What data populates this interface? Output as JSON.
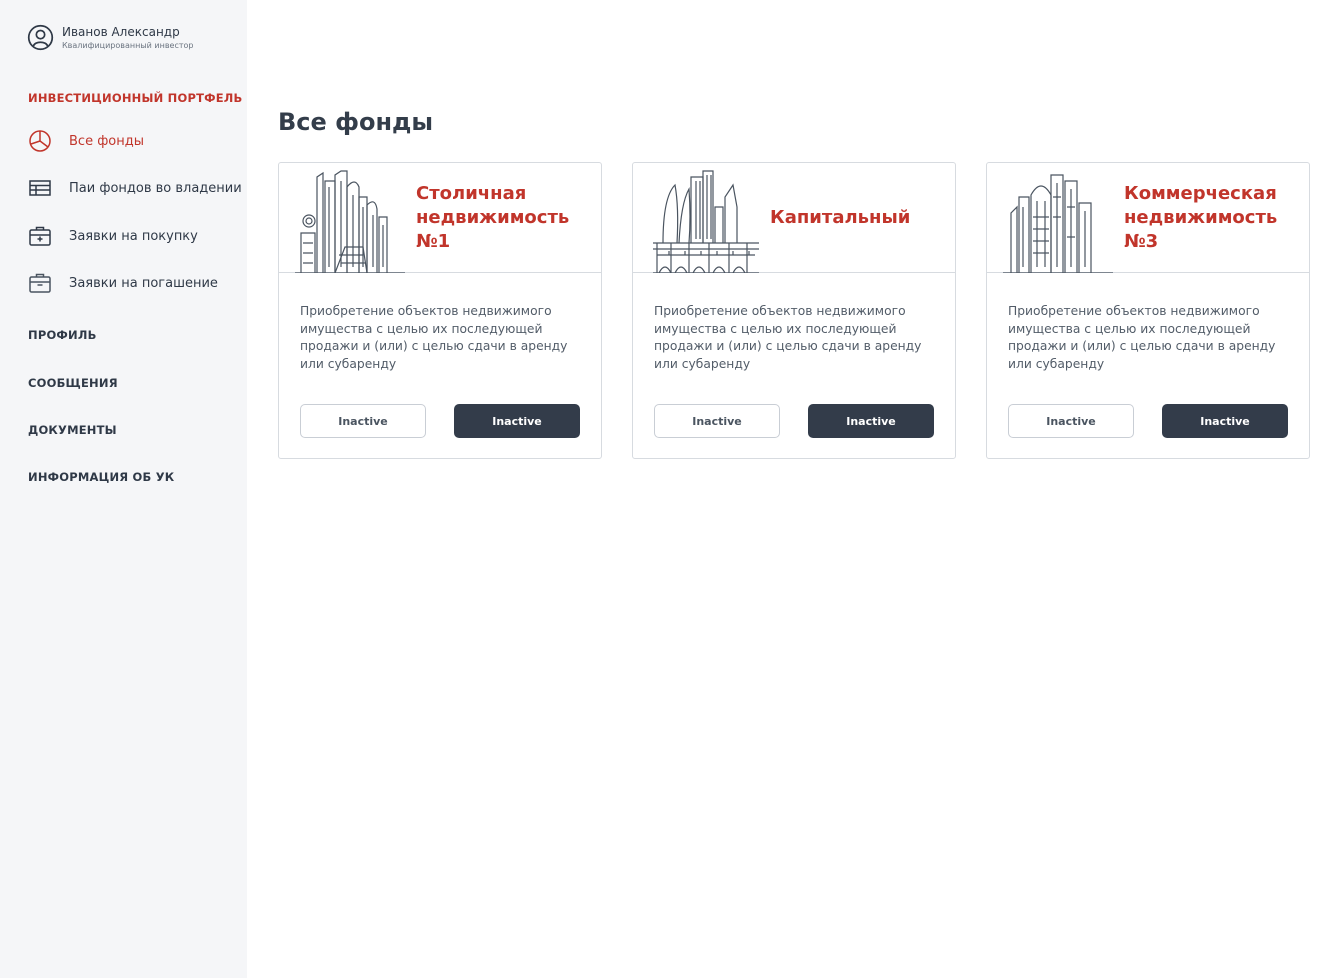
{
  "user": {
    "name": "Иванов Александр",
    "role": "Квалифицированный инвестор"
  },
  "sidebar": {
    "sections": [
      {
        "label": "ИНВЕСТИЦИОННЫЙ ПОРТФЕЛЬ",
        "active": true
      },
      {
        "label": "ПРОФИЛЬ"
      },
      {
        "label": "СООБЩЕНИЯ"
      },
      {
        "label": "ДОКУМЕНТЫ"
      },
      {
        "label": "ИНФОРМАЦИЯ ОБ УК"
      }
    ],
    "items": [
      {
        "label": "Все фонды",
        "icon": "pie-chart-icon",
        "active": true
      },
      {
        "label": "Паи фондов во владении",
        "icon": "table-icon"
      },
      {
        "label": "Заявки на покупку",
        "icon": "briefcase-plus-icon"
      },
      {
        "label": "Заявки на погашение",
        "icon": "briefcase-minus-icon"
      }
    ]
  },
  "page": {
    "title": "Все фонды"
  },
  "funds": [
    {
      "title": "Столичная недвижимость №1",
      "description": "Приобретение объектов недвижимого имущества с целью их последующей продажи и (или) с целью сдачи в аренду или субаренду",
      "button_left": "Inactive",
      "button_right": "Inactive"
    },
    {
      "title": "Капитальный",
      "description": "Приобретение объектов недвижимого имущества с целью их последующей продажи и (или) с целью сдачи в аренду или субаренду",
      "button_left": "Inactive",
      "button_right": "Inactive"
    },
    {
      "title": "Коммерческая недвижимость №3",
      "description": "Приобретение объектов недвижимого имущества с целью их последующей продажи и (или) с целью сдачи в аренду или субаренду",
      "button_left": "Inactive",
      "button_right": "Inactive"
    }
  ],
  "colors": {
    "accent": "#c1352b",
    "dark": "#333c4a",
    "sidebar_bg": "#f5f6f8"
  }
}
